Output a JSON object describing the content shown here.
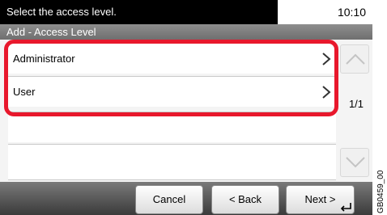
{
  "status": {
    "message": "Select the access level.",
    "time": "10:10"
  },
  "title": "Add - Access Level",
  "options": [
    {
      "label": "Administrator",
      "icon": "chevron-right-icon"
    },
    {
      "label": "User",
      "icon": "chevron-right-icon"
    }
  ],
  "pagination": {
    "indicator": "1/1",
    "up_icon": "scroll-up-icon",
    "down_icon": "scroll-down-icon"
  },
  "buttons": {
    "cancel": "Cancel",
    "back": "< Back",
    "next": "Next >",
    "enter_icon": "enter-icon"
  },
  "reference_code": "GB0459_00",
  "colors": {
    "highlight": "#e8182c",
    "status_bar": "#000000",
    "title_bar": "#7f7f7f"
  }
}
